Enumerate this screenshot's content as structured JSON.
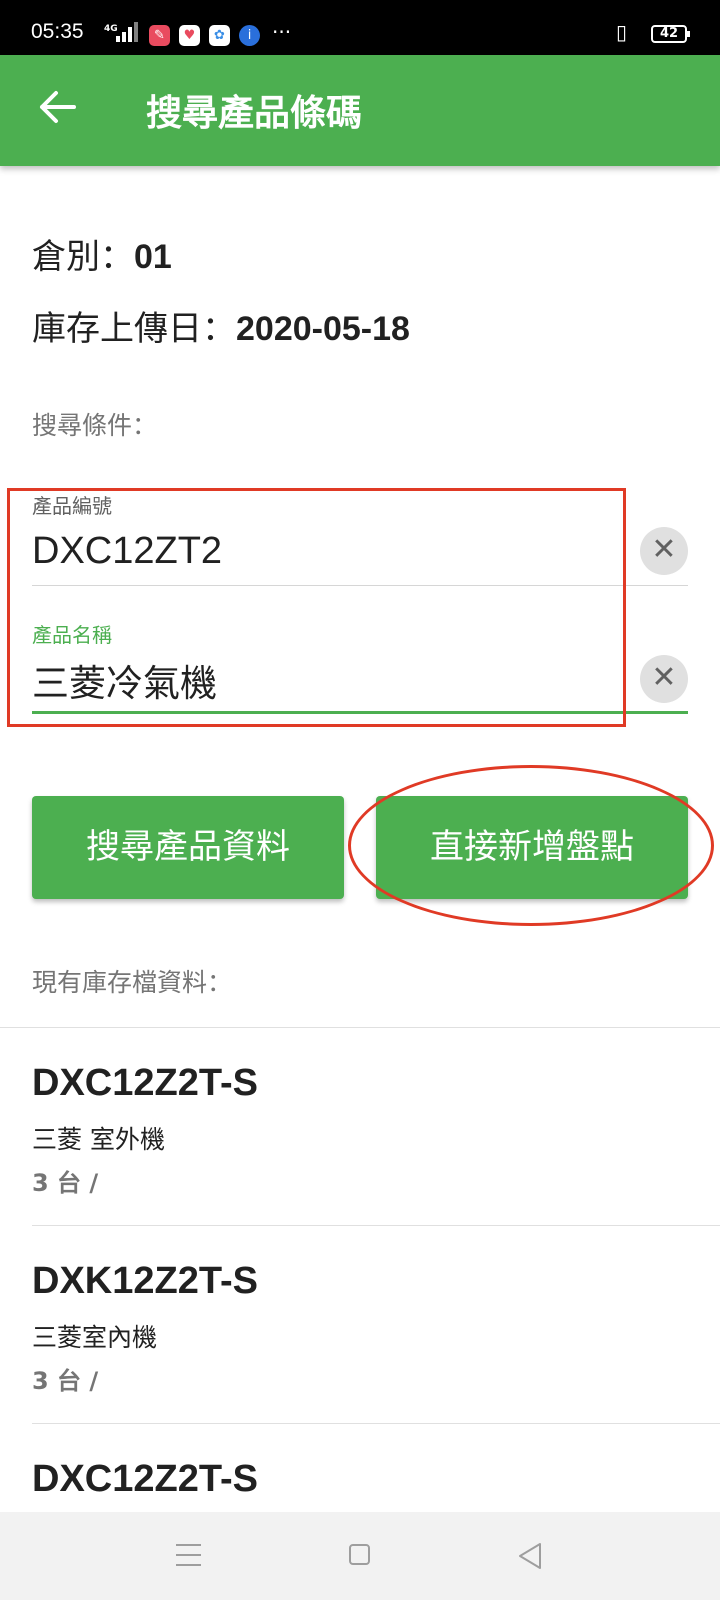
{
  "status_bar": {
    "time": "05:35",
    "network": "4G",
    "overflow": "···",
    "battery": "42",
    "icons": [
      "pin-app-icon",
      "health-app-icon",
      "photos-app-icon",
      "info-app-icon",
      "vibrate-icon",
      "battery-icon"
    ]
  },
  "header": {
    "back_icon": "arrow-left-icon",
    "title": "搜尋產品條碼"
  },
  "info": {
    "warehouse_label": "倉別：",
    "warehouse_value": "01",
    "upload_label": "庫存上傳日：",
    "upload_value": "2020-05-18"
  },
  "search": {
    "section_label": "搜尋條件：",
    "product_code_label": "產品編號",
    "product_code_value": "DXC12ZT2",
    "product_name_label": "產品名稱",
    "product_name_value": "三菱冷氣機",
    "clear_icon": "✕"
  },
  "actions": {
    "search_button": "搜尋產品資料",
    "add_button": "直接新增盤點"
  },
  "inventory": {
    "section_label": "現有庫存檔資料：",
    "items": [
      {
        "code": "DXC12Z2T-S",
        "name": "三菱 室外機",
        "qty": "3 台 /"
      },
      {
        "code": "DXK12Z2T-S",
        "name": "三菱室內機",
        "qty": "3 台 /"
      },
      {
        "code": "DXC12Z2T-S"
      }
    ]
  },
  "colors": {
    "primary": "#4caf50",
    "highlight": "#e03a25",
    "muted": "#757575",
    "status_bar": "#000000"
  }
}
